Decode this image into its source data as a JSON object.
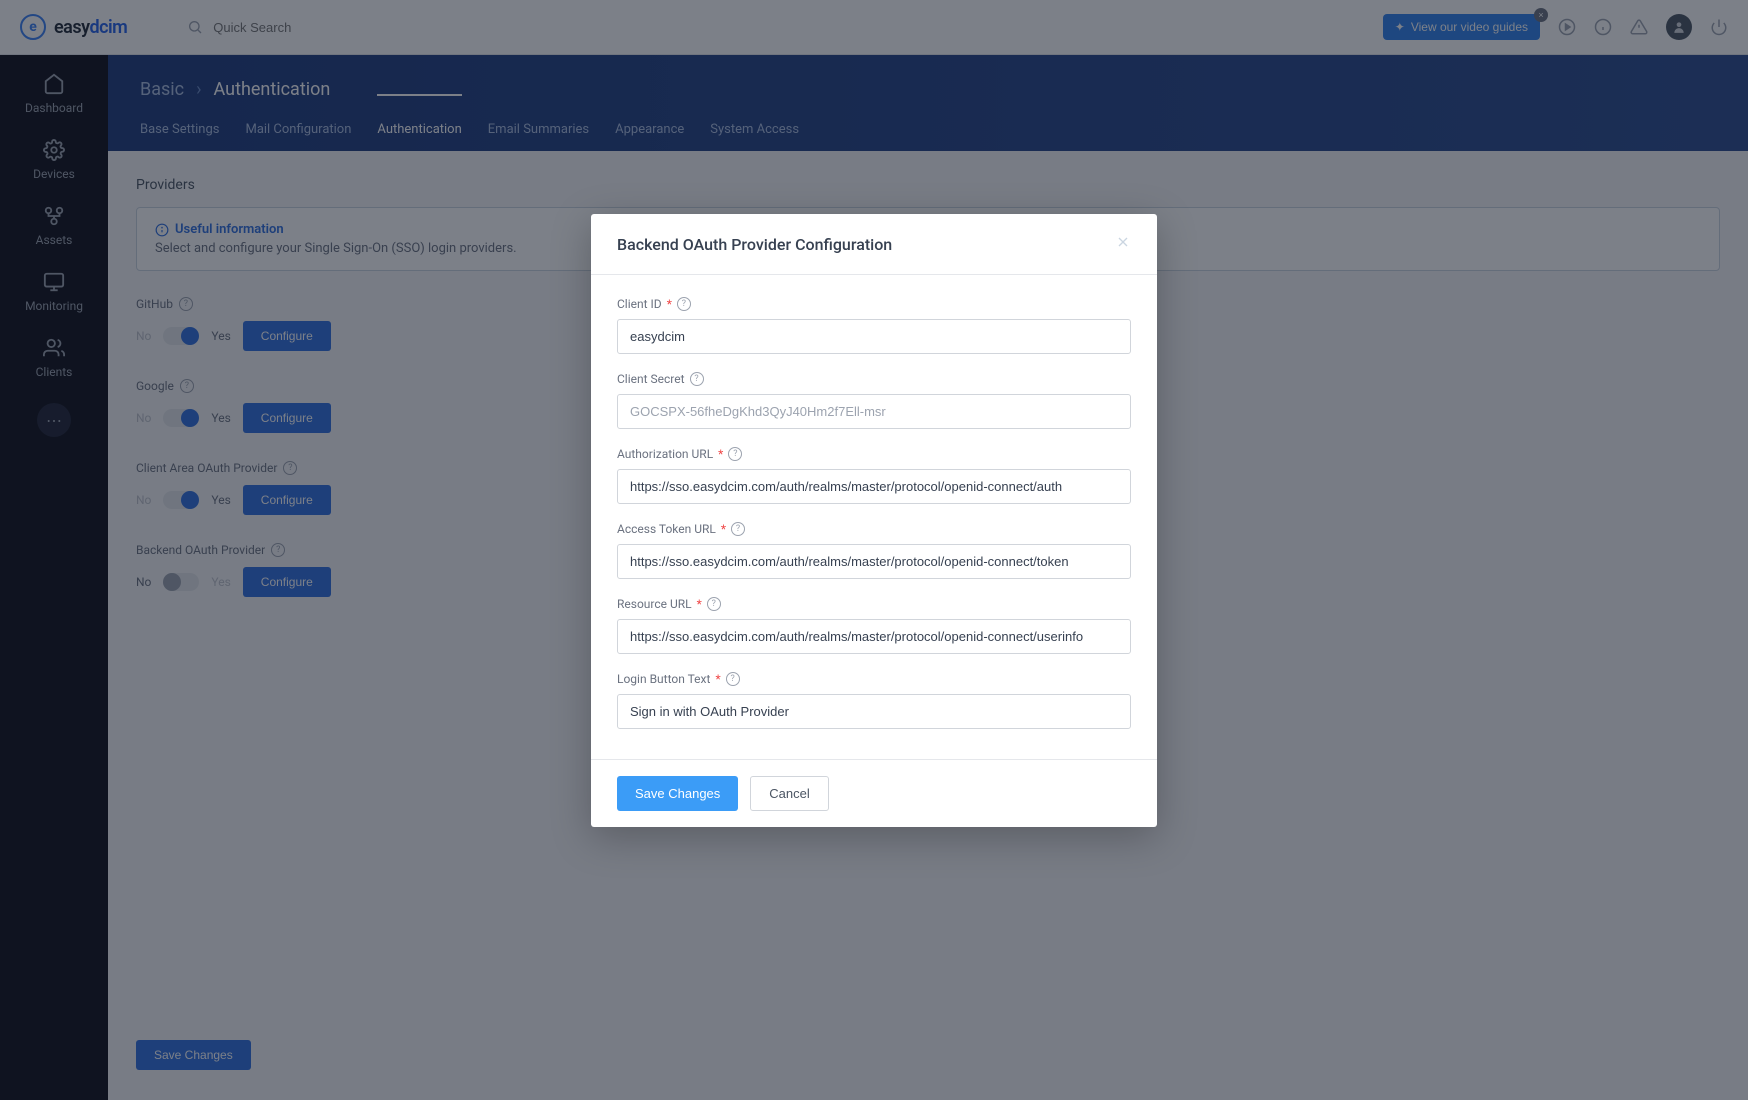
{
  "header": {
    "logo_text_a": "easy",
    "logo_text_b": "dcim",
    "search_placeholder": "Quick Search",
    "video_guides_label": "View our video guides"
  },
  "sidebar": {
    "items": [
      {
        "label": "Dashboard"
      },
      {
        "label": "Devices"
      },
      {
        "label": "Assets"
      },
      {
        "label": "Monitoring"
      },
      {
        "label": "Clients"
      }
    ]
  },
  "breadcrumb": {
    "root": "Basic",
    "current": "Authentication"
  },
  "tabs": [
    {
      "label": "Base Settings"
    },
    {
      "label": "Mail Configuration"
    },
    {
      "label": "Authentication"
    },
    {
      "label": "Email Summaries"
    },
    {
      "label": "Appearance"
    },
    {
      "label": "System Access"
    }
  ],
  "providers_section": {
    "title": "Providers",
    "info_title": "Useful information",
    "info_text": "Select and configure your Single Sign-On (SSO) login providers.",
    "toggle_no": "No",
    "toggle_yes": "Yes",
    "configure": "Configure",
    "save_changes": "Save Changes",
    "items": [
      {
        "name": "GitHub",
        "on": true
      },
      {
        "name": "Google",
        "on": true
      },
      {
        "name": "Client Area OAuth Provider",
        "on": true
      },
      {
        "name": "Backend OAuth Provider",
        "on": false
      }
    ]
  },
  "modal": {
    "title": "Backend OAuth Provider Configuration",
    "fields": {
      "client_id": {
        "label": "Client ID",
        "value": "easydcim",
        "required": true
      },
      "client_secret": {
        "label": "Client Secret",
        "placeholder": "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",
        "required": false
      },
      "auth_url": {
        "label": "Authorization URL",
        "value": "https://sso.easydcim.com/auth/realms/master/protocol/openid-connect/auth",
        "required": true
      },
      "token_url": {
        "label": "Access Token URL",
        "value": "https://sso.easydcim.com/auth/realms/master/protocol/openid-connect/token",
        "required": true
      },
      "resource_url": {
        "label": "Resource URL",
        "value": "https://sso.easydcim.com/auth/realms/master/protocol/openid-connect/userinfo",
        "required": true
      },
      "login_text": {
        "label": "Login Button Text",
        "value": "Sign in with OAuth Provider",
        "required": true
      }
    },
    "save": "Save Changes",
    "cancel": "Cancel"
  }
}
